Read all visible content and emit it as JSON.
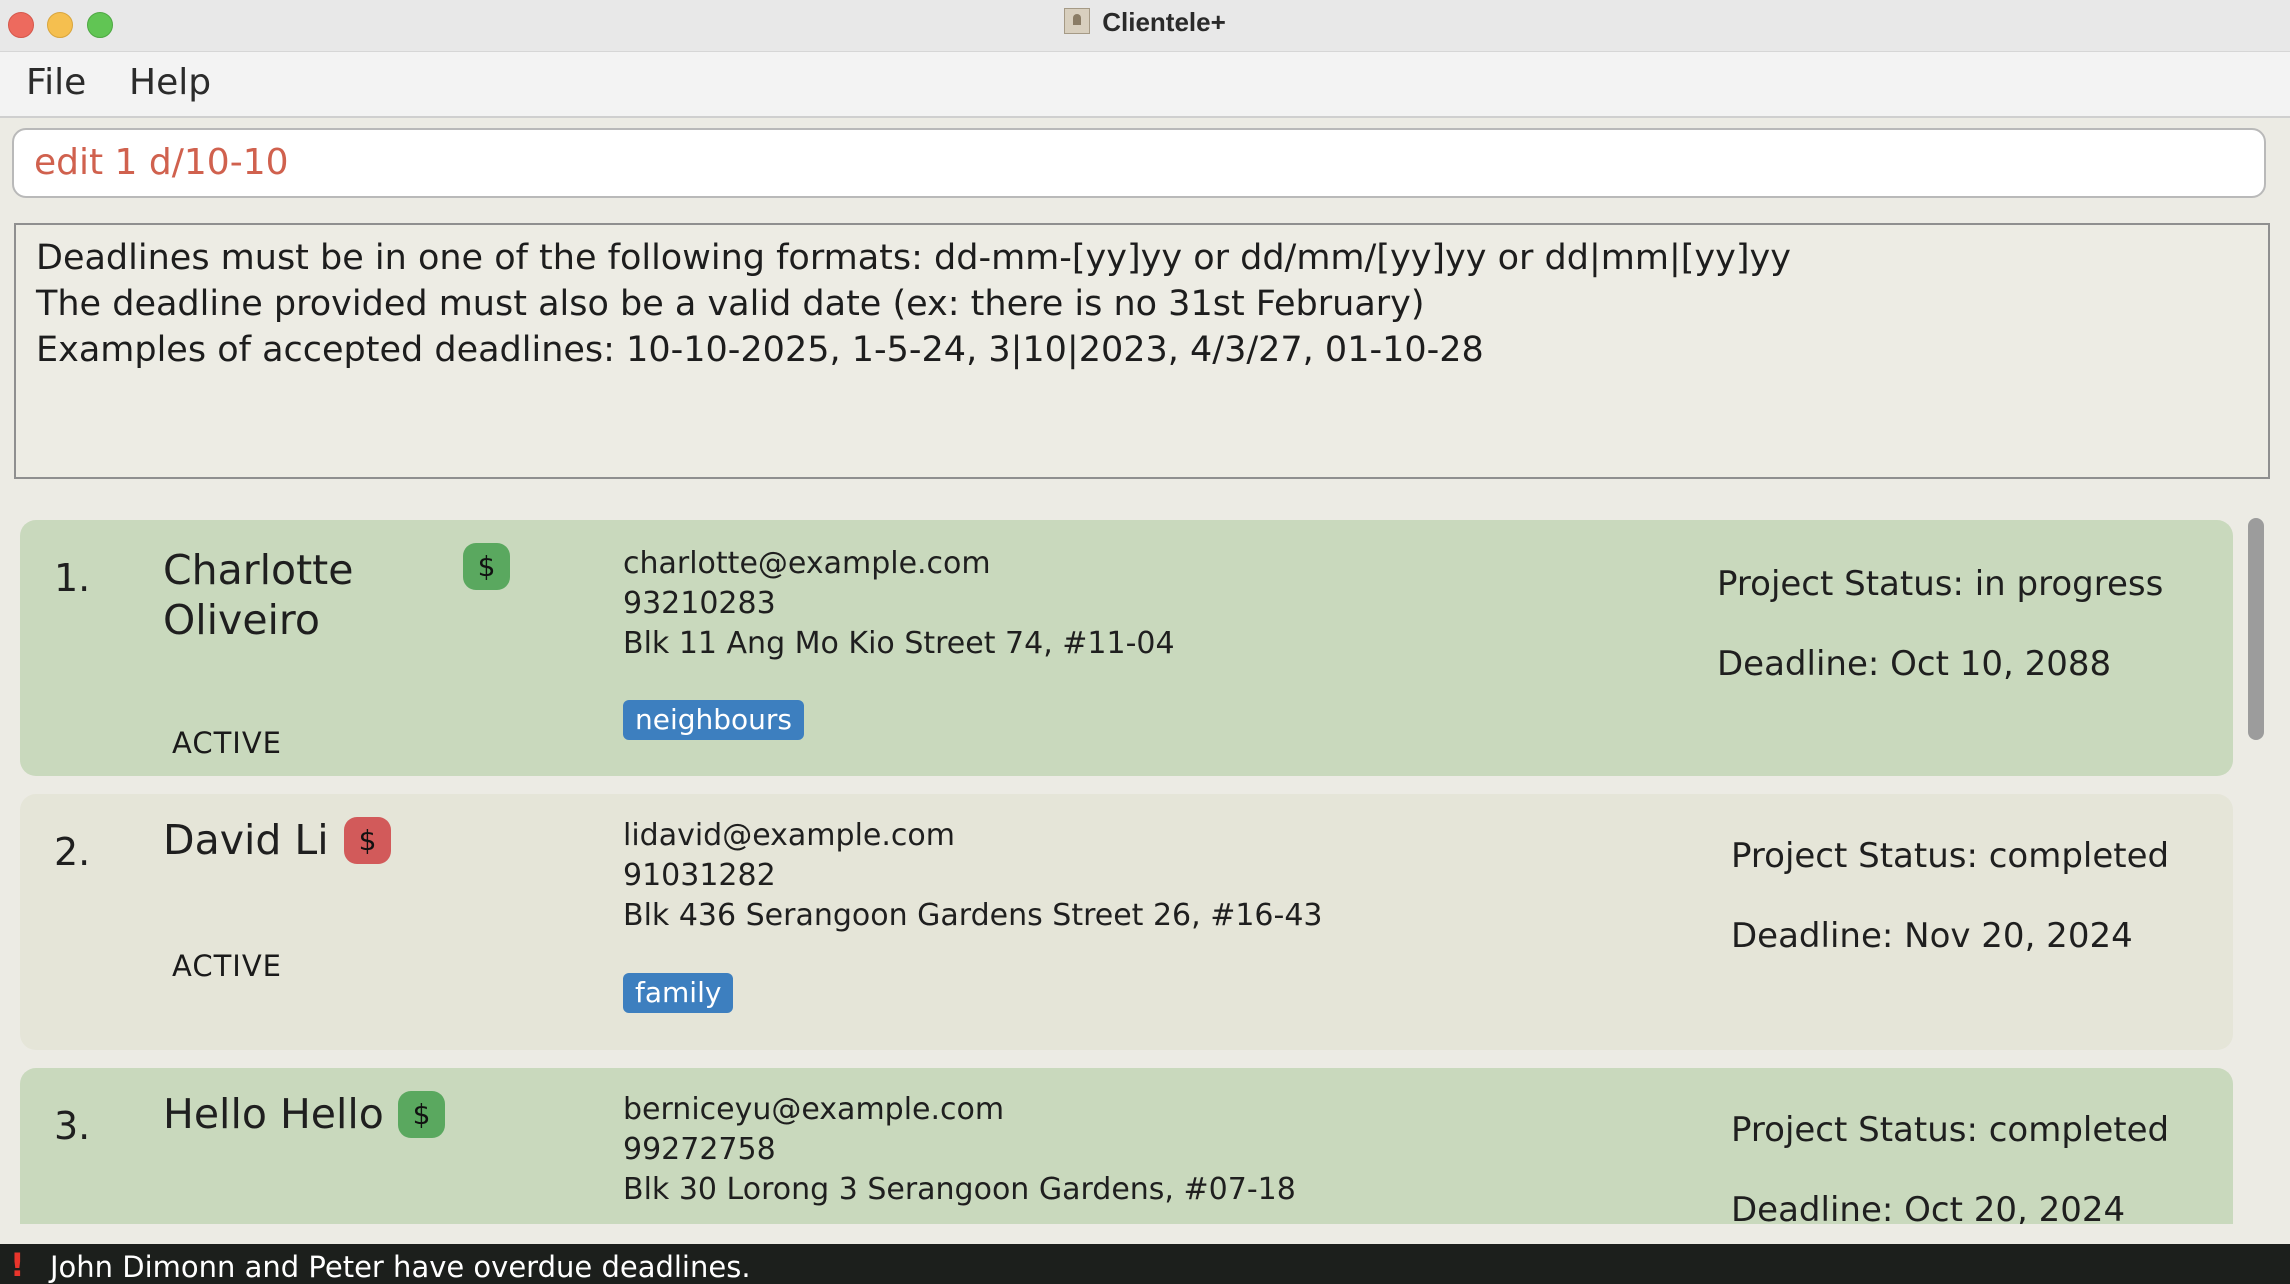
{
  "window": {
    "title": "Clientele+"
  },
  "menu": {
    "items": [
      "File",
      "Help"
    ]
  },
  "command": {
    "value": "edit 1 d/10-10"
  },
  "result": {
    "lines": [
      "Deadlines must be in one of the following formats: dd-mm-[yy]yy or dd/mm/[yy]yy or dd|mm|[yy]yy",
      "The deadline provided must also be a valid date (ex: there is no 31st February)",
      "Examples of accepted deadlines: 10-10-2025, 1-5-24, 3|10|2023, 4/3/27, 01-10-28"
    ]
  },
  "clients": [
    {
      "index": "1.",
      "name_line1": "Charlotte",
      "name_line2": "Oliveiro",
      "payment_icon": "$",
      "payment_status": "paid",
      "status": "ACTIVE",
      "email": "charlotte@example.com",
      "phone": "93210283",
      "address": "Blk 11 Ang Mo Kio Street 74, #11-04",
      "tag": "neighbours",
      "project_status": "Project Status: in progress",
      "deadline": "Deadline: Oct 10, 2088"
    },
    {
      "index": "2.",
      "name": "David Li",
      "payment_icon": "$",
      "payment_status": "unpaid",
      "status": "ACTIVE",
      "email": "lidavid@example.com",
      "phone": "91031282",
      "address": "Blk 436 Serangoon Gardens Street 26, #16-43",
      "tag": "family",
      "project_status": "Project Status: completed",
      "deadline": "Deadline: Nov 20, 2024"
    },
    {
      "index": "3.",
      "name": "Hello Hello",
      "payment_icon": "$",
      "payment_status": "paid",
      "email": "berniceyu@example.com",
      "phone": "99272758",
      "address": "Blk 30 Lorong 3 Serangoon Gardens, #07-18",
      "project_status": "Project Status: completed",
      "deadline": "Deadline: Oct 20, 2024"
    }
  ],
  "statusbar": {
    "icon": "!",
    "message": "John Dimonn and Peter have overdue deadlines."
  },
  "colors": {
    "card_green": "#c9d9bd",
    "card_beige": "#e5e5d8",
    "paid_badge": "#5aa85f",
    "unpaid_badge": "#d25a5a",
    "tag": "#3d7fbf",
    "command_text": "#d0614e",
    "statusbar_bg": "#1c1f1c",
    "alert": "#e8352b"
  }
}
